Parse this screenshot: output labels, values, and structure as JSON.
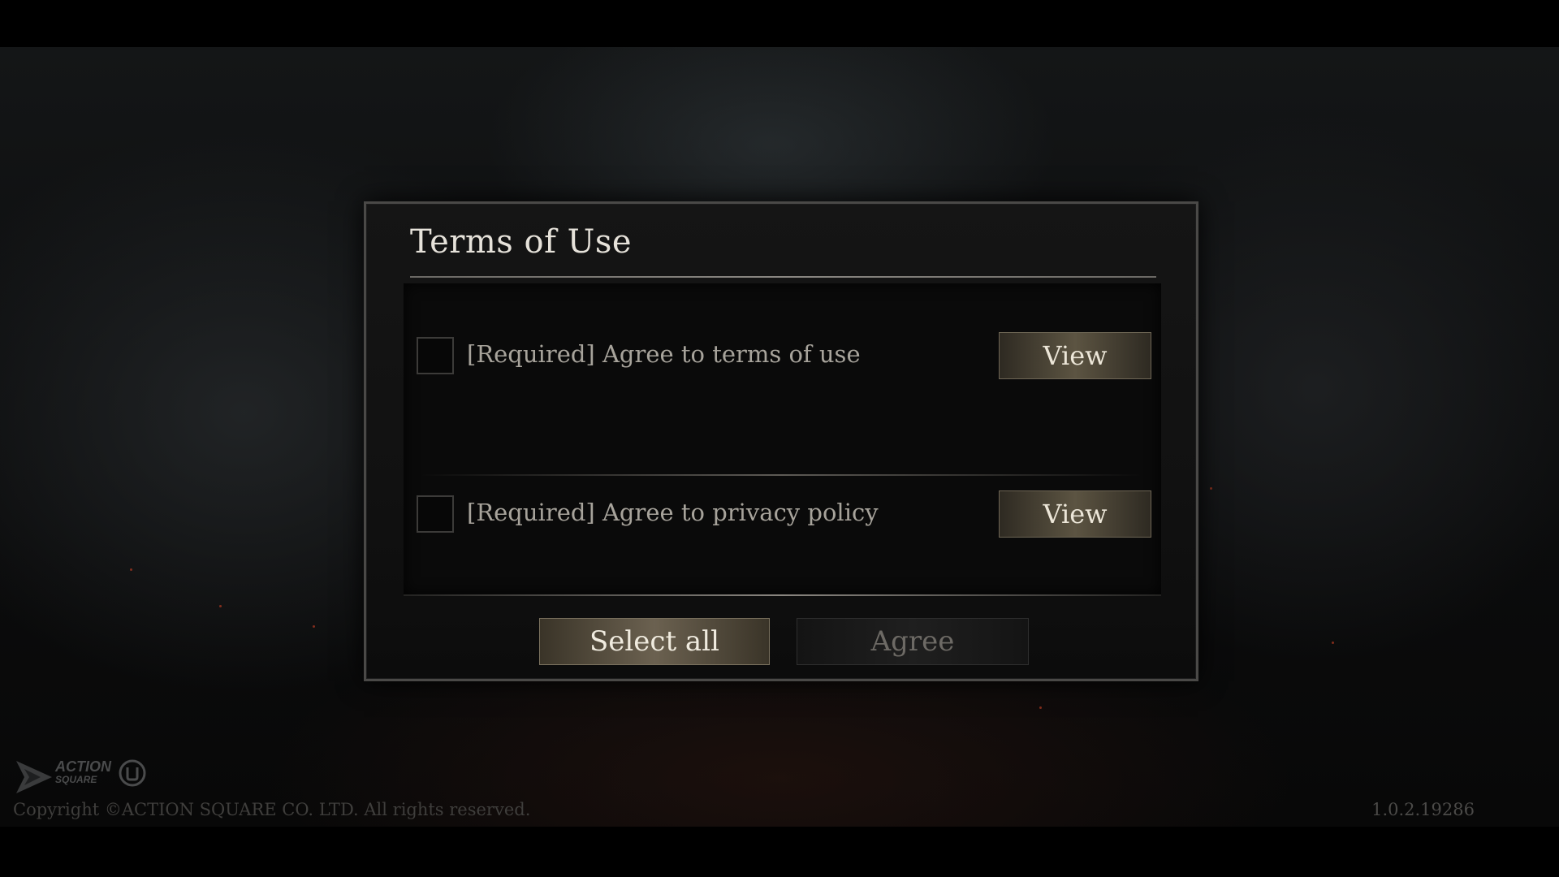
{
  "dialog": {
    "title": "Terms of Use",
    "items": [
      {
        "label": "[Required] Agree to terms of use",
        "checked": false,
        "view_label": "View"
      },
      {
        "label": "[Required] Agree to privacy policy",
        "checked": false,
        "view_label": "View"
      }
    ],
    "select_all_label": "Select all",
    "agree_label": "Agree",
    "agree_enabled": false
  },
  "footer": {
    "logo_text_line1": "ACTION",
    "logo_text_line2": "SQUARE",
    "copyright": "Copyright ©ACTION SQUARE CO. LTD. All rights reserved.",
    "version": "1.0.2.19286"
  },
  "icons": {
    "logo": "action-square-logo-icon",
    "engine": "unreal-engine-logo-icon"
  },
  "colors": {
    "gold_button": "#6b6150",
    "disabled_button_text": "#6d6a65",
    "title_text": "#e6e2da",
    "ember": "#b23a22"
  }
}
